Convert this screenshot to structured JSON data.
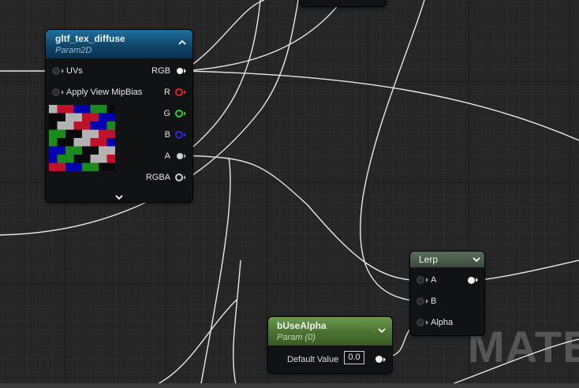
{
  "nodes": {
    "tex": {
      "title": "gltf_tex_diffuse",
      "subtitle": "Param2D",
      "inputs": [
        "UVs",
        "Apply View MipBias"
      ],
      "outputs": [
        "RGB",
        "R",
        "G",
        "B",
        "A",
        "RGBA"
      ],
      "output_colors": [
        "#f0f0f0",
        "#e0202a",
        "#2ad02a",
        "#2a2ae8",
        "#f0f0f0",
        "#f0f0f0"
      ]
    },
    "lerp": {
      "title": "Lerp",
      "inputs": [
        "A",
        "B",
        "Alpha"
      ]
    },
    "param": {
      "title": "bUseAlpha",
      "subtitle": "Param (0)",
      "field_label": "Default Value",
      "field_value": "0.0"
    }
  },
  "watermark": "MATE",
  "icons": {
    "collapse": "chevron-up-icon",
    "expand": "chevron-down-icon"
  }
}
